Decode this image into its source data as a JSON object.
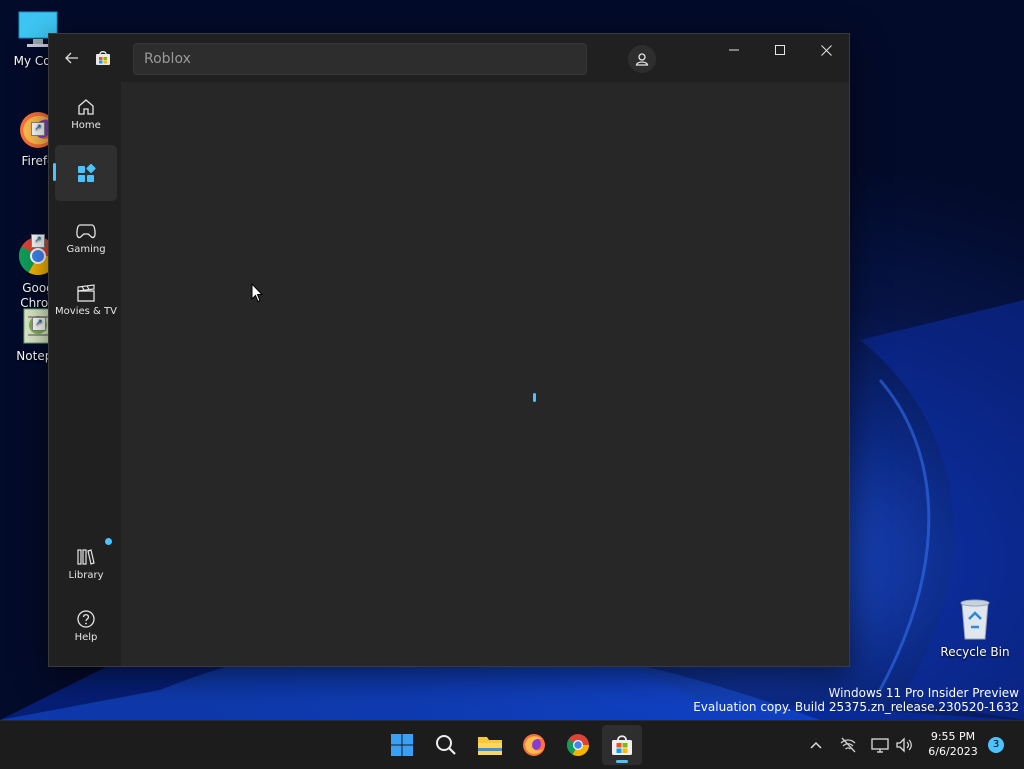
{
  "desktop": {
    "icons": [
      {
        "label": "My Com",
        "icon": "monitor-icon"
      },
      {
        "label": "Firefo",
        "icon": "firefox-icon"
      },
      {
        "label": "Goog\nChron",
        "icon": "chrome-icon"
      },
      {
        "label": "Notepa",
        "icon": "notepad-icon"
      }
    ],
    "recycle_bin": {
      "label": "Recycle Bin",
      "icon": "recycle-bin-icon"
    },
    "watermark": {
      "line1": "Windows 11 Pro Insider Preview",
      "line2": "Evaluation copy. Build 25375.zn_release.230520-1632"
    }
  },
  "store_window": {
    "search_value": "Roblox",
    "controls": {
      "minimize": "minimize-icon",
      "maximize": "maximize-icon",
      "close": "close-icon"
    },
    "nav": [
      {
        "label": "Home",
        "icon": "home-icon"
      },
      {
        "label": "",
        "icon": "apps-icon",
        "selected": true
      },
      {
        "label": "Gaming",
        "icon": "gamepad-icon"
      },
      {
        "label": "Movies & TV",
        "icon": "clapperboard-icon"
      }
    ],
    "nav_bottom": [
      {
        "label": "Library",
        "icon": "library-icon",
        "badge": true
      },
      {
        "label": "Help",
        "icon": "help-icon"
      }
    ],
    "accent_color": "#4cc2ff",
    "loading": true
  },
  "taskbar": {
    "apps": [
      "start-icon",
      "search-icon",
      "file-explorer-icon",
      "firefox-icon",
      "chrome-icon",
      "microsoft-store-icon"
    ],
    "active_app": "microsoft-store-icon",
    "tray": [
      "chevron-up-icon",
      "network-off-icon",
      "display-icon",
      "volume-icon"
    ],
    "time": "9:55 PM",
    "date": "6/6/2023",
    "notification_count": "3"
  }
}
